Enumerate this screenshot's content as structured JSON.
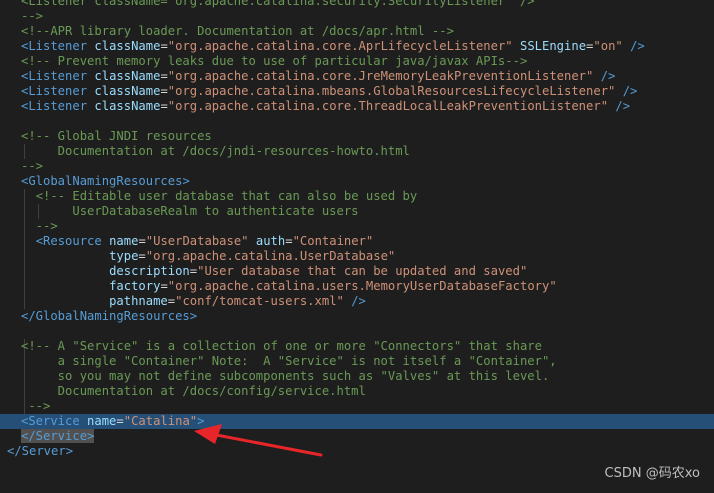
{
  "lines": [
    {
      "t": "<Listener className=\"org.apache.catalina.security.SecurityListener\" />"
    },
    {
      "t": "-->"
    },
    {
      "t": "<!--APR library loader. Documentation at /docs/apr.html -->"
    },
    {
      "t": "<Listener className=\"org.apache.catalina.core.AprLifecycleListener\" SSLEngine=\"on\" />"
    },
    {
      "t": "<!-- Prevent memory leaks due to use of particular java/javax APIs-->"
    },
    {
      "t": "<Listener className=\"org.apache.catalina.core.JreMemoryLeakPreventionListener\" />"
    },
    {
      "t": "<Listener className=\"org.apache.catalina.mbeans.GlobalResourcesLifecycleListener\" />"
    },
    {
      "t": "<Listener className=\"org.apache.catalina.core.ThreadLocalLeakPreventionListener\" />"
    },
    {
      "t": ""
    },
    {
      "t": "<!-- Global JNDI resources"
    },
    {
      "t": "     Documentation at /docs/jndi-resources-howto.html"
    },
    {
      "t": "-->"
    },
    {
      "t": "<GlobalNamingResources>"
    },
    {
      "t": "  <!-- Editable user database that can also be used by"
    },
    {
      "t": "       UserDatabaseRealm to authenticate users"
    },
    {
      "t": "  -->"
    },
    {
      "t": "  <Resource name=\"UserDatabase\" auth=\"Container\""
    },
    {
      "t": "            type=\"org.apache.catalina.UserDatabase\""
    },
    {
      "t": "            description=\"User database that can be updated and saved\""
    },
    {
      "t": "            factory=\"org.apache.catalina.users.MemoryUserDatabaseFactory\""
    },
    {
      "t": "            pathname=\"conf/tomcat-users.xml\" />"
    },
    {
      "t": "</GlobalNamingResources>"
    },
    {
      "t": ""
    },
    {
      "t": "<!-- A \"Service\" is a collection of one or more \"Connectors\" that share"
    },
    {
      "t": "     a single \"Container\" Note:  A \"Service\" is not itself a \"Container\","
    },
    {
      "t": "     so you may not define subcomponents such as \"Valves\" at this level."
    },
    {
      "t": "     Documentation at /docs/config/service.html"
    },
    {
      "t": " -->"
    },
    {
      "t": "<Service name=\"Catalina\">"
    },
    {
      "t": "</Service>"
    },
    {
      "t": "</Server>"
    }
  ],
  "watermark": "CSDN @码农xo",
  "colors": {
    "background": "#1e1e1e",
    "highlight_row": "#264f78",
    "tag": "#569cd6",
    "attribute": "#9cdcfe",
    "string": "#ce9178",
    "comment": "#6a9955",
    "arrow": "#e8262a"
  },
  "highlighted_line_index": 28
}
